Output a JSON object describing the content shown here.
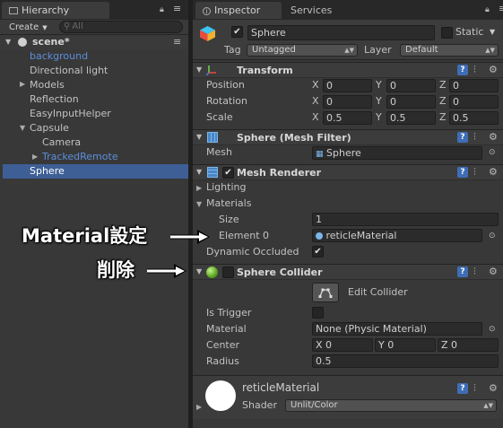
{
  "hierarchy": {
    "tab_label": "Hierarchy",
    "create_label": "Create",
    "search_placeholder": "All",
    "scene_name": "scene*",
    "items": [
      {
        "label": "background"
      },
      {
        "label": "Directional light"
      },
      {
        "label": "Models"
      },
      {
        "label": "Reflection"
      },
      {
        "label": "EasyInputHelper"
      },
      {
        "label": "Capsule"
      },
      {
        "label": "Camera"
      },
      {
        "label": "TrackedRemote"
      },
      {
        "label": "Sphere"
      }
    ]
  },
  "inspector": {
    "tabs": [
      {
        "label": "Inspector"
      },
      {
        "label": "Services"
      }
    ],
    "object_name": "Sphere",
    "static_label": "Static",
    "tag_label": "Tag",
    "tag_value": "Untagged",
    "layer_label": "Layer",
    "layer_value": "Default",
    "transform": {
      "title": "Transform",
      "position_label": "Position",
      "rotation_label": "Rotation",
      "scale_label": "Scale",
      "x": "X",
      "y": "Y",
      "z": "Z",
      "position": [
        "0",
        "0",
        "0"
      ],
      "rotation": [
        "0",
        "0",
        "0"
      ],
      "scale": [
        "0.5",
        "0.5",
        "0.5"
      ]
    },
    "mesh_filter": {
      "title": "Sphere (Mesh Filter)",
      "mesh_label": "Mesh",
      "mesh_value": "Sphere"
    },
    "mesh_renderer": {
      "title": "Mesh Renderer",
      "lighting_label": "Lighting",
      "materials_label": "Materials",
      "size_label": "Size",
      "size_value": "1",
      "element0_label": "Element 0",
      "element0_value": "reticleMaterial",
      "dynamic_occluded_label": "Dynamic Occluded",
      "dynamic_occluded_checked": true
    },
    "sphere_collider": {
      "title": "Sphere Collider",
      "edit_collider_label": "Edit Collider",
      "is_trigger_label": "Is Trigger",
      "is_trigger_checked": false,
      "material_label": "Material",
      "material_value": "None (Physic Material)",
      "center_label": "Center",
      "center": [
        "0",
        "0",
        "0"
      ],
      "x": "X",
      "y": "Y",
      "z": "Z",
      "radius_label": "Radius",
      "radius_value": "0.5"
    },
    "material_asset": {
      "name": "reticleMaterial",
      "shader_label": "Shader",
      "shader_value": "Unlit/Color"
    }
  },
  "annotations": {
    "material_setting": "Material設定",
    "delete": "削除"
  },
  "colors": {
    "selection": "#3e5f96",
    "prefab_blue": "#5b8fdc",
    "panel_bg": "#383838",
    "field_bg": "#2b2b2b",
    "help_blue": "#3e6db5"
  },
  "icons": [
    "lock-icon",
    "menu-icon",
    "search-icon",
    "unity-scene-icon",
    "cube-icon",
    "transform-axes-icon",
    "grid-icon",
    "sphere-collider-icon",
    "help-icon",
    "preset-icon",
    "gear-icon",
    "object-picker-icon",
    "edit-collider-icon",
    "material-preview-icon"
  ]
}
